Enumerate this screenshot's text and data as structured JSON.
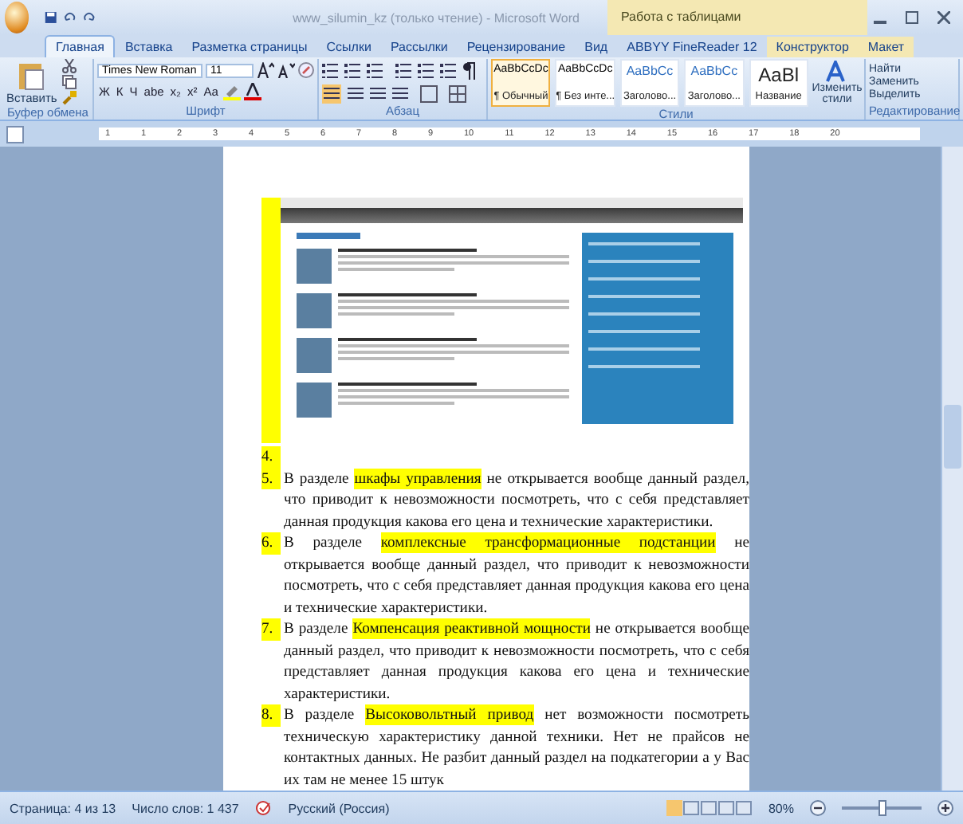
{
  "window": {
    "title": "www_silumin_kz (только чтение) - Microsoft Word",
    "context_tab": "Работа с таблицами"
  },
  "tabs": [
    {
      "label": "Главная",
      "selected": true
    },
    {
      "label": "Вставка",
      "selected": false
    },
    {
      "label": "Разметка страницы",
      "selected": false
    },
    {
      "label": "Ссылки",
      "selected": false
    },
    {
      "label": "Рассылки",
      "selected": false
    },
    {
      "label": "Рецензирование",
      "selected": false
    },
    {
      "label": "Вид",
      "selected": false
    },
    {
      "label": "ABBYY FineReader 12",
      "selected": false
    },
    {
      "label": "Конструктор",
      "selected": false
    },
    {
      "label": "Макет",
      "selected": false
    }
  ],
  "ribbon": {
    "clipboard": {
      "paste": "Вставить",
      "label": "Буфер обмена"
    },
    "font": {
      "name": "Times New Roman",
      "size": "11",
      "buttons": [
        "Ж",
        "К",
        "Ч",
        "abe",
        "x₂",
        "x²",
        "Aa"
      ],
      "label": "Шрифт"
    },
    "paragraph": {
      "label": "Абзац"
    },
    "styles": {
      "items": [
        {
          "sample": "AaBbCcDc",
          "name": "¶ Обычный",
          "selected": true
        },
        {
          "sample": "AaBbCcDc",
          "name": "¶ Без инте...",
          "selected": false
        },
        {
          "sample": "AaBbCc",
          "name": "Заголово...",
          "selected": false
        },
        {
          "sample": "AaBbCc",
          "name": "Заголово...",
          "selected": false
        },
        {
          "sample": "AaBl",
          "name": "Название",
          "selected": false
        }
      ],
      "change": "Изменить стили",
      "label": "Стили"
    },
    "editing": {
      "items": [
        "Найти",
        "Заменить",
        "Выделить"
      ],
      "label": "Редактирование"
    }
  },
  "ruler": [
    "1",
    "1",
    "2",
    "3",
    "4",
    "5",
    "6",
    "7",
    "8",
    "9",
    "10",
    "11",
    "12",
    "13",
    "14",
    "15",
    "16",
    "17",
    "18",
    "20"
  ],
  "document": {
    "list": [
      {
        "number": "4."
      },
      {
        "number": "5.",
        "before": "В разделе ",
        "highlight": "шкафы управления",
        "after": " не открывается вообще данный раздел, что приводит к невозможности посмотреть, что с себя представляет данная продукция какова его цена и технические характеристики."
      },
      {
        "number": "6.",
        "before": "В разделе ",
        "highlight": "комплексные трансформационные подстанции",
        "after": " не открывается вообще данный раздел, что приводит к невозможности посмотреть, что с себя представляет данная продукция какова его цена и технические характеристики."
      },
      {
        "number": "7.",
        "before": "В разделе ",
        "highlight": "Компенсация реактивной мощности",
        "after": " не открывается вообще данный раздел, что приводит к невозможности посмотреть, что с себя представляет данная продукция какова его цена и технические характеристики."
      },
      {
        "number": "8.",
        "before": "В разделе ",
        "highlight": "Высоковольтный привод",
        "after": " нет возможности посмотреть техническую характеристику данной техники. Нет не прайсов не контактных данных.  Не разбит данный раздел на подкатегории а у Вас их там не менее 15 штук"
      }
    ]
  },
  "status_bar": {
    "page": "Страница: 4 из 13",
    "words": "Число слов: 1 437",
    "language": "Русский (Россия)",
    "zoom": "80%",
    "zoom_slider": {
      "level": 0.5
    }
  }
}
